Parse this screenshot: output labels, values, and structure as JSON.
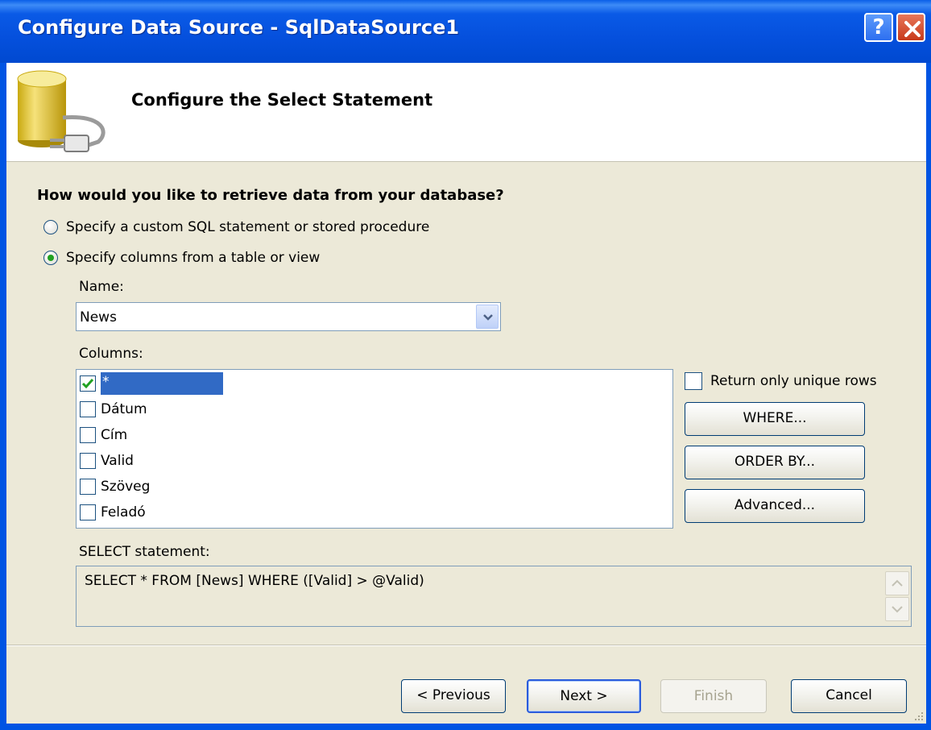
{
  "window": {
    "title": "Configure Data Source - SqlDataSource1",
    "help_glyph": "?",
    "close_icon": "close-icon"
  },
  "header": {
    "title": "Configure the Select Statement",
    "icon": "database-plug-icon"
  },
  "main": {
    "question": "How would you like to retrieve data from your database?",
    "options": [
      {
        "label": "Specify a custom SQL statement or stored procedure",
        "checked": false
      },
      {
        "label": "Specify columns from a table or view",
        "checked": true
      }
    ],
    "name_label": "Name:",
    "name_value": "News",
    "columns_label": "Columns:",
    "columns": [
      {
        "label": "*",
        "checked": true,
        "selected": true
      },
      {
        "label": "Dátum",
        "checked": false
      },
      {
        "label": "Cím",
        "checked": false
      },
      {
        "label": "Valid",
        "checked": false
      },
      {
        "label": "Szöveg",
        "checked": false
      },
      {
        "label": "Feladó",
        "checked": false
      }
    ],
    "unique_rows_label": "Return only unique rows",
    "where_label": "WHERE...",
    "order_by_label": "ORDER BY...",
    "advanced_label": "Advanced...",
    "select_label": "SELECT statement:",
    "select_text": "SELECT * FROM [News] WHERE ([Valid] > @Valid)"
  },
  "footer": {
    "previous_label": "< Previous",
    "next_label": "Next >",
    "finish_label": "Finish",
    "cancel_label": "Cancel"
  },
  "colors": {
    "titlebar": "#0054e3",
    "selection": "#316ac5",
    "check": "#21a121"
  }
}
